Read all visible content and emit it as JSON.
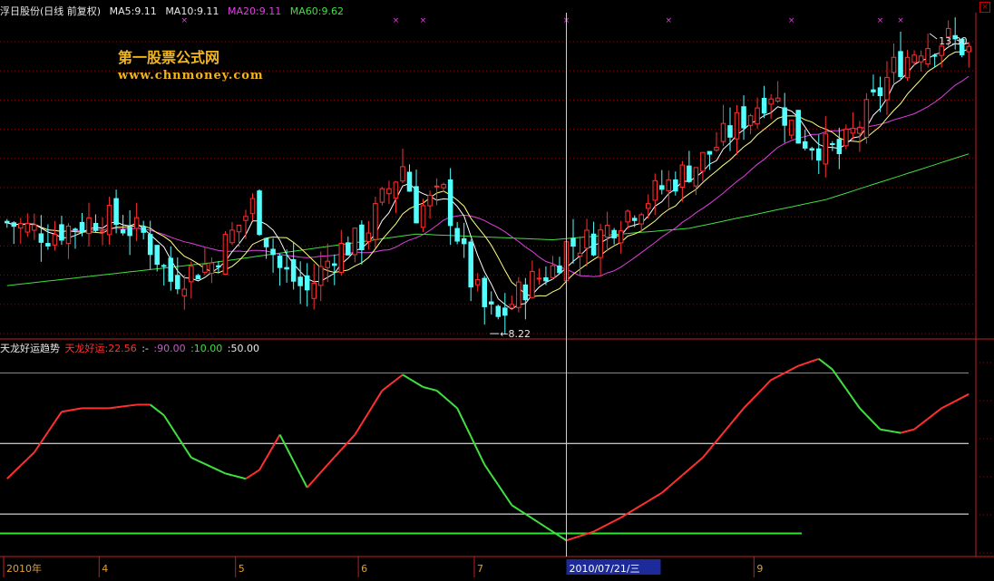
{
  "header": {
    "stock": "浮日股份(日线 前复权)",
    "ma5": "MA5:9.11",
    "ma10": "MA10:9.11",
    "ma20": "MA20:9.11",
    "ma60": "MA60:9.62",
    "colors": {
      "stock": "#e8e8e8",
      "ma5": "#e8e8e8",
      "ma10": "#e8e8e8",
      "ma20": "#e040e0",
      "ma60": "#40e040"
    }
  },
  "watermark": {
    "line1": "第一股票公式网",
    "line2": "www.chnmoney.com"
  },
  "close_icon": "close-icon",
  "price_annotations": {
    "high": "13.30",
    "low": "8.22"
  },
  "indicator_header": {
    "name": "天龙好运趋势",
    "value_label": "天龙好运:22.56",
    "sep": ":-",
    "l90": ":90.00",
    "l10": ":10.00",
    "l50": ":50.00"
  },
  "date_axis": {
    "labels": [
      "2010年",
      "4",
      "5",
      "6",
      "7",
      "9"
    ],
    "cursor_date": "2010/07/21/三"
  },
  "chart_data": [
    {
      "type": "candlestick",
      "title": "",
      "ylim": [
        8.0,
        13.6
      ],
      "x_count": 142,
      "high": 13.3,
      "low": 8.22,
      "cursor_index": 82,
      "colors": {
        "up": "#ff3030",
        "down": "#54ffff",
        "ma5": "#ffffff",
        "ma10": "#ffff80",
        "ma20": "#e040e0",
        "ma60": "#40e040"
      },
      "close_anchors": [
        [
          0,
          10.0
        ],
        [
          6,
          9.8
        ],
        [
          14,
          10.1
        ],
        [
          20,
          9.8
        ],
        [
          24,
          9.0
        ],
        [
          30,
          9.3
        ],
        [
          36,
          10.3
        ],
        [
          40,
          9.2
        ],
        [
          44,
          8.8
        ],
        [
          48,
          9.5
        ],
        [
          52,
          9.7
        ],
        [
          56,
          10.6
        ],
        [
          58,
          11.0
        ],
        [
          60,
          10.2
        ],
        [
          64,
          10.5
        ],
        [
          66,
          9.8
        ],
        [
          68,
          9.0
        ],
        [
          70,
          8.5
        ],
        [
          72,
          8.3
        ],
        [
          76,
          8.9
        ],
        [
          80,
          9.2
        ],
        [
          82,
          9.6
        ],
        [
          86,
          9.7
        ],
        [
          90,
          10.1
        ],
        [
          96,
          10.6
        ],
        [
          102,
          11.1
        ],
        [
          106,
          11.6
        ],
        [
          112,
          12.3
        ],
        [
          116,
          11.5
        ],
        [
          122,
          11.2
        ],
        [
          126,
          11.9
        ],
        [
          130,
          12.7
        ],
        [
          134,
          13.1
        ],
        [
          138,
          13.2
        ],
        [
          141,
          13.0
        ]
      ],
      "ma60_anchors": [
        [
          0,
          8.9
        ],
        [
          30,
          9.3
        ],
        [
          60,
          9.8
        ],
        [
          80,
          9.7
        ],
        [
          100,
          9.9
        ],
        [
          120,
          10.4
        ],
        [
          141,
          11.2
        ]
      ]
    },
    {
      "type": "line",
      "title": "",
      "ylim": [
        -10,
        100
      ],
      "levels": [
        90,
        10,
        50,
        -1
      ],
      "level_colors": [
        "#c060c0",
        "#ffffff",
        "#ffffff",
        "#30e030"
      ],
      "up_color": "#ff3030",
      "down_color": "#40e040",
      "anchors": [
        [
          0,
          30
        ],
        [
          4,
          45
        ],
        [
          8,
          68
        ],
        [
          11,
          70
        ],
        [
          15,
          70
        ],
        [
          19,
          72
        ],
        [
          21,
          72
        ],
        [
          23,
          66
        ],
        [
          27,
          42
        ],
        [
          32,
          33
        ],
        [
          35,
          30
        ],
        [
          37,
          35
        ],
        [
          40,
          55
        ],
        [
          44,
          25
        ],
        [
          47,
          38
        ],
        [
          51,
          55
        ],
        [
          55,
          80
        ],
        [
          58,
          89
        ],
        [
          61,
          82
        ],
        [
          63,
          80
        ],
        [
          66,
          70
        ],
        [
          70,
          38
        ],
        [
          74,
          15
        ],
        [
          78,
          5
        ],
        [
          82,
          -5
        ],
        [
          86,
          0
        ],
        [
          90,
          8
        ],
        [
          96,
          22
        ],
        [
          102,
          42
        ],
        [
          108,
          70
        ],
        [
          112,
          86
        ],
        [
          116,
          94
        ],
        [
          119,
          98
        ],
        [
          121,
          92
        ],
        [
          125,
          70
        ],
        [
          128,
          58
        ],
        [
          131,
          56
        ],
        [
          133,
          58
        ],
        [
          137,
          70
        ],
        [
          141,
          78
        ]
      ],
      "last_value": 22.56
    }
  ]
}
